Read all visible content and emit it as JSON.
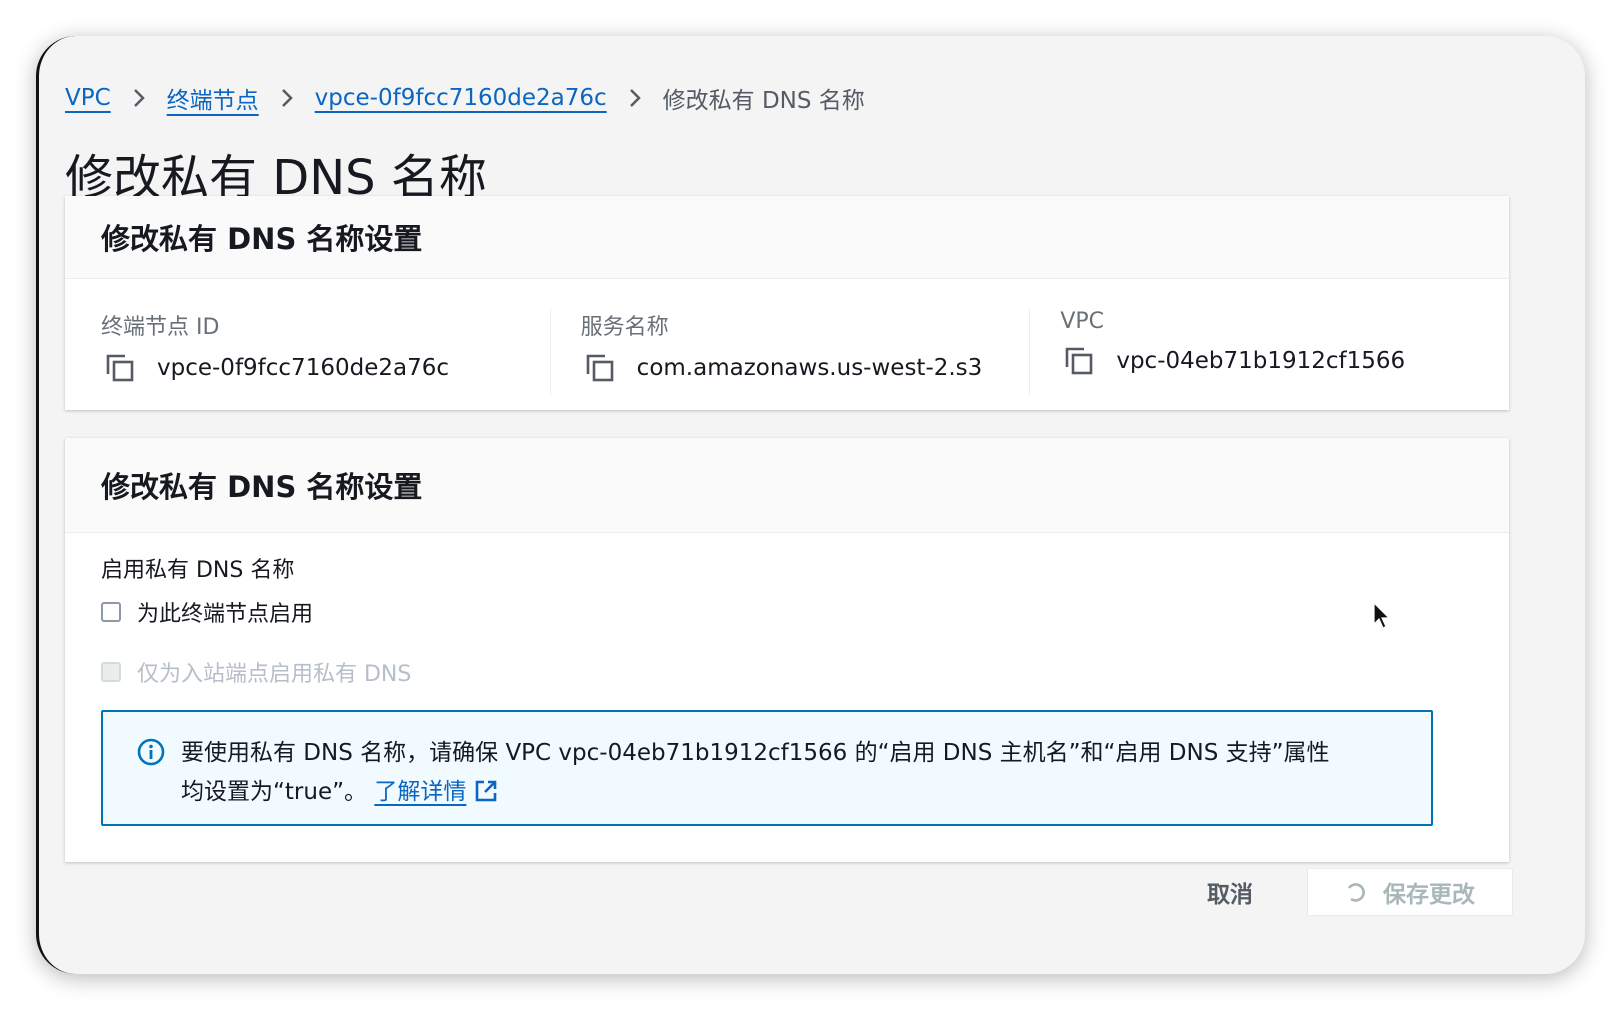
{
  "breadcrumb": {
    "items": [
      {
        "label": "VPC"
      },
      {
        "label": "终端节点"
      },
      {
        "label": "vpce-0f9fcc7160de2a76c"
      }
    ],
    "current": "修改私有 DNS 名称"
  },
  "page": {
    "title": "修改私有 DNS 名称"
  },
  "details_panel": {
    "header": "修改私有 DNS 名称设置",
    "fields": [
      {
        "label": "终端节点 ID",
        "value": "vpce-0f9fcc7160de2a76c",
        "icon": "copy-icon"
      },
      {
        "label": "服务名称",
        "value": "com.amazonaws.us-west-2.s3",
        "icon": "copy-icon"
      },
      {
        "label": "VPC",
        "value": "vpc-04eb71b1912cf1566",
        "icon": "copy-icon"
      }
    ]
  },
  "settings_panel": {
    "header": "修改私有 DNS 名称设置",
    "field_label": "启用私有 DNS 名称",
    "checkbox_enable": {
      "label": "为此终端节点启用",
      "checked": false
    },
    "checkbox_inbound": {
      "label": "仅为入站端点启用私有 DNS",
      "checked": false,
      "disabled": true
    },
    "alert": {
      "icon": "info-icon",
      "line1": "要使用私有 DNS 名称，请确保 VPC vpc-04eb71b1912cf1566 的“启用 DNS 主机名”和“启用 DNS 支持”属性",
      "line2": "均设置为“true”。",
      "link_label": "了解详情",
      "link_icon": "external-link-icon"
    }
  },
  "footer": {
    "cancel_label": "取消",
    "save_label": "保存更改",
    "save_icon": "spinner-icon"
  },
  "colors": {
    "link": "#0a66c2",
    "info_border": "#0073bb",
    "info_background": "#f1faff",
    "disabled_text": "#b6bec9"
  }
}
